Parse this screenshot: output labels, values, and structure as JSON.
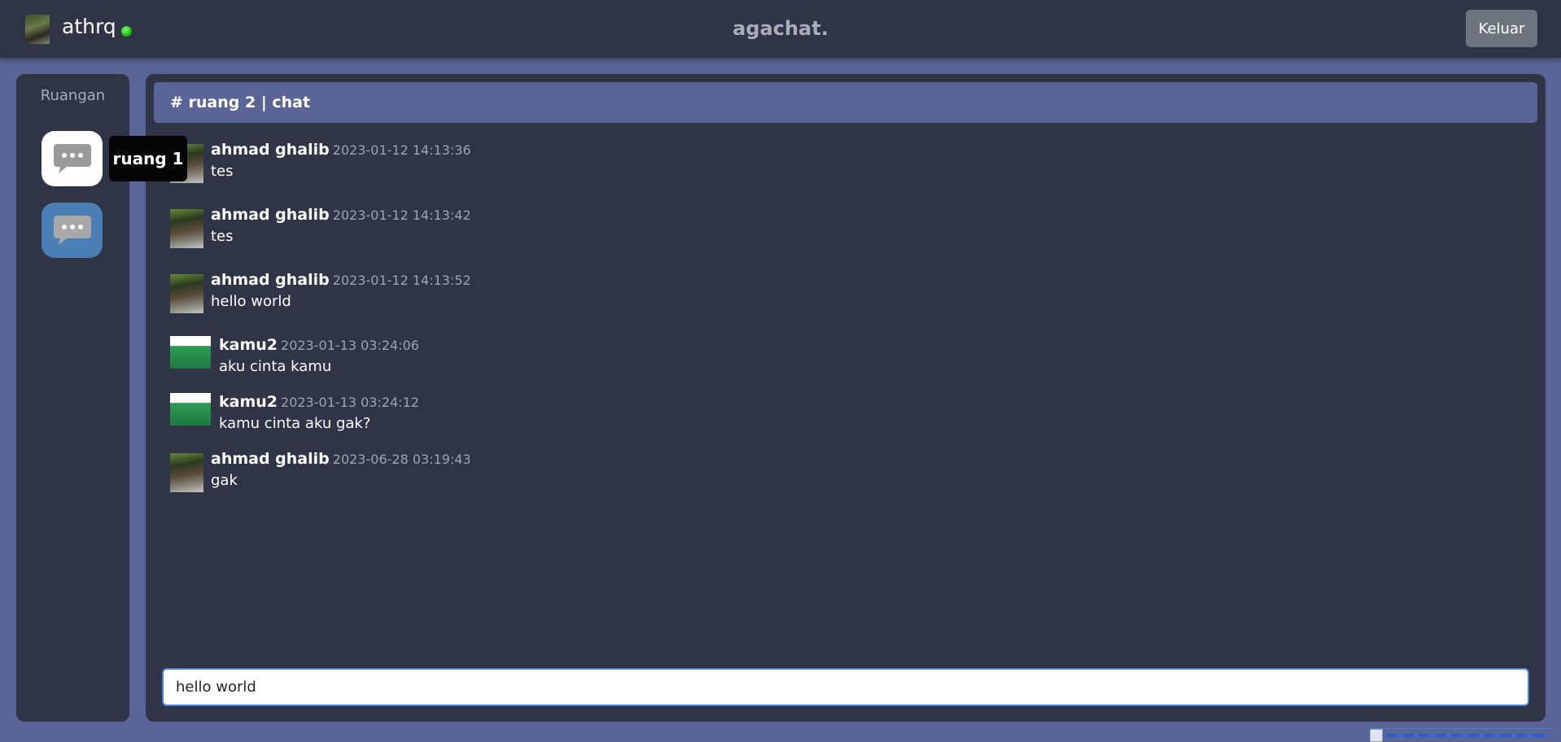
{
  "navbar": {
    "username": "athrq",
    "status": "online",
    "app_title": "agachat.",
    "logout_label": "Keluar"
  },
  "sidebar": {
    "title": "Ruangan",
    "rooms": [
      {
        "icon": "chat-bubble-icon",
        "tooltip": "ruang 1"
      },
      {
        "icon": "chat-bubble-icon"
      }
    ],
    "hovered_tooltip": "ruang 1"
  },
  "chat": {
    "header": "# ruang 2 | chat",
    "messages": [
      {
        "user": "ahmad ghalib",
        "time": "2023-01-12 14:13:36",
        "text": "tes"
      },
      {
        "user": "ahmad ghalib",
        "time": "2023-01-12 14:13:42",
        "text": "tes"
      },
      {
        "user": "ahmad ghalib",
        "time": "2023-01-12 14:13:52",
        "text": "hello world"
      },
      {
        "user": "kamu2",
        "time": "2023-01-13 03:24:06",
        "text": "aku cinta kamu"
      },
      {
        "user": "kamu2",
        "time": "2023-01-13 03:24:12",
        "text": "kamu cinta aku gak?"
      },
      {
        "user": "ahmad ghalib",
        "time": "2023-06-28 03:19:43",
        "text": "gak"
      }
    ],
    "input_value": "hello world"
  },
  "colors": {
    "background": "#5a6496",
    "panel": "#2f3546",
    "header": "#5a6496",
    "room_active": "#ffffff",
    "room_inactive": "#4a7fb5",
    "logout_button": "#6c757d",
    "online": "#22c31a"
  }
}
